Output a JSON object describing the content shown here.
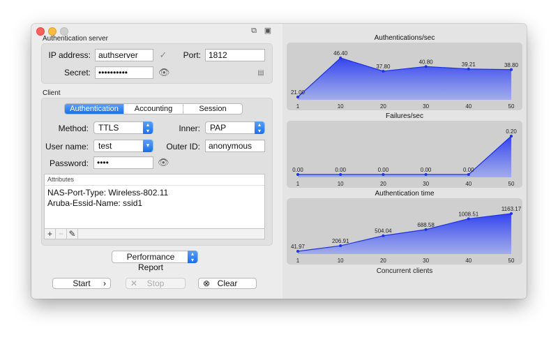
{
  "toolbar_icons": [
    "windows-icon",
    "save-icon"
  ],
  "server": {
    "section_title": "Authentication server",
    "ip_label": "IP address:",
    "ip_value": "authserver",
    "port_label": "Port:",
    "port_value": "1812",
    "secret_label": "Secret:",
    "secret_value": "••••••••••"
  },
  "client": {
    "section_title": "Client",
    "tabs": [
      {
        "label": "Authentication",
        "active": true
      },
      {
        "label": "Accounting",
        "active": false
      },
      {
        "label": "Session",
        "active": false
      }
    ],
    "method_label": "Method:",
    "method_value": "TTLS",
    "inner_label": "Inner:",
    "inner_value": "PAP",
    "username_label": "User name:",
    "username_value": "test",
    "outer_id_label": "Outer ID:",
    "outer_id_value": "anonymous",
    "password_label": "Password:",
    "password_value": "••••",
    "attributes_header": "Attributes",
    "attributes": [
      "NAS-Port-Type: Wireless-802.11",
      "Aruba-Essid-Name: ssid1"
    ],
    "attr_tools": [
      "+",
      "−",
      "✎"
    ]
  },
  "report_select": "Performance Report",
  "actions": {
    "start": "Start",
    "stop": "Stop",
    "clear": "Clear"
  },
  "chart_data": [
    {
      "type": "area",
      "title": "Authentications/sec",
      "x": [
        1,
        10,
        20,
        30,
        40,
        50
      ],
      "values": [
        21.0,
        46.4,
        37.8,
        40.8,
        39.21,
        38.8
      ],
      "labels": [
        "21.00",
        "46.40",
        "37.80",
        "40.80",
        "39.21",
        "38.80"
      ],
      "color": "#1d32e6"
    },
    {
      "type": "area",
      "title": "Failures/sec",
      "x": [
        1,
        10,
        20,
        30,
        40,
        50
      ],
      "values": [
        0,
        0,
        0,
        0,
        0,
        0.2
      ],
      "labels": [
        "0.00",
        "0.00",
        "0.00",
        "0.00",
        "0.00",
        "0.20"
      ],
      "color": "#1d32e6"
    },
    {
      "type": "area",
      "title": "Authentication time",
      "x": [
        1,
        10,
        20,
        30,
        40,
        50
      ],
      "values": [
        41.97,
        206.91,
        504.04,
        688.58,
        1008.51,
        1163.17
      ],
      "labels": [
        "41.97",
        "206.91",
        "504.04",
        "688.58",
        "1008.51",
        "1163.17"
      ],
      "color": "#1d32e6"
    }
  ],
  "xlabel": "Concurrent clients"
}
